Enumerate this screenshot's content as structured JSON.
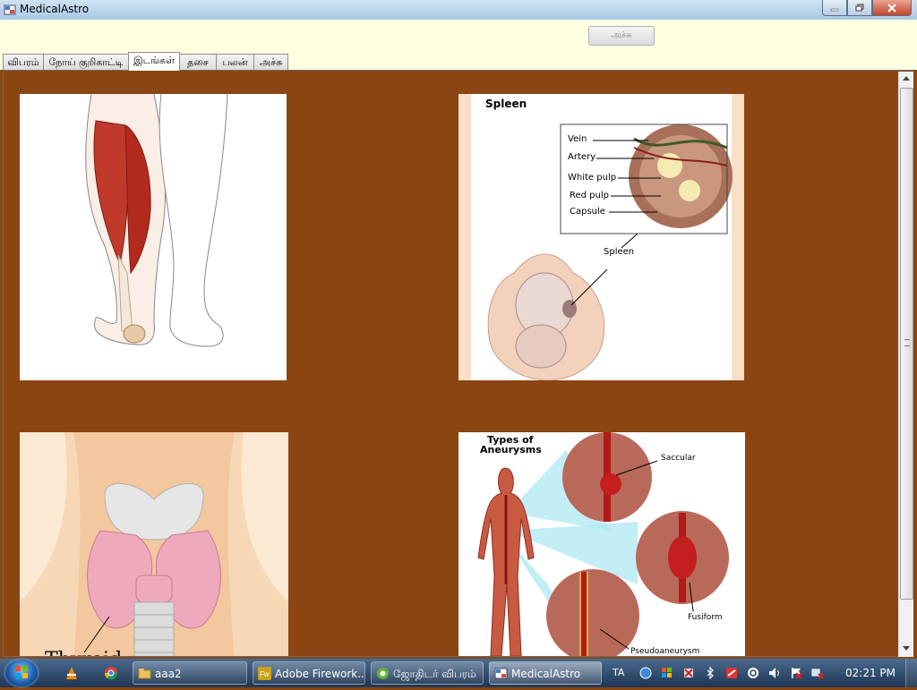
{
  "window": {
    "title": "MedicalAstro"
  },
  "toolbar": {
    "print_label": "அச்சு"
  },
  "tabs": [
    {
      "label": "விபரம்",
      "active": false
    },
    {
      "label": "நோய் குறிகாட்டி",
      "active": false
    },
    {
      "label": "இடங்கள்",
      "active": true
    },
    {
      "label": "தசை",
      "active": false
    },
    {
      "label": "பலன்",
      "active": false
    },
    {
      "label": "அச்சு",
      "active": false
    }
  ],
  "images": {
    "spleen": {
      "title": "Spleen",
      "labels": [
        "Vein",
        "Artery",
        "White pulp",
        "Red pulp",
        "Capsule",
        "Spleen"
      ]
    },
    "thyroid": {
      "caption": "Thyroid"
    },
    "aneurysms": {
      "title_line1": "Types of",
      "title_line2": "Aneurysms",
      "labels": [
        "Saccular",
        "Fusiform",
        "Pseudoaneurysm"
      ]
    }
  },
  "taskbar": {
    "tasks": [
      {
        "label": "aaa2"
      },
      {
        "label": "Adobe Firework..."
      },
      {
        "label": "ஜோதிடர் விபரம்"
      },
      {
        "label": "MedicalAstro"
      }
    ],
    "language": "TA",
    "clock": "02:21 PM"
  }
}
